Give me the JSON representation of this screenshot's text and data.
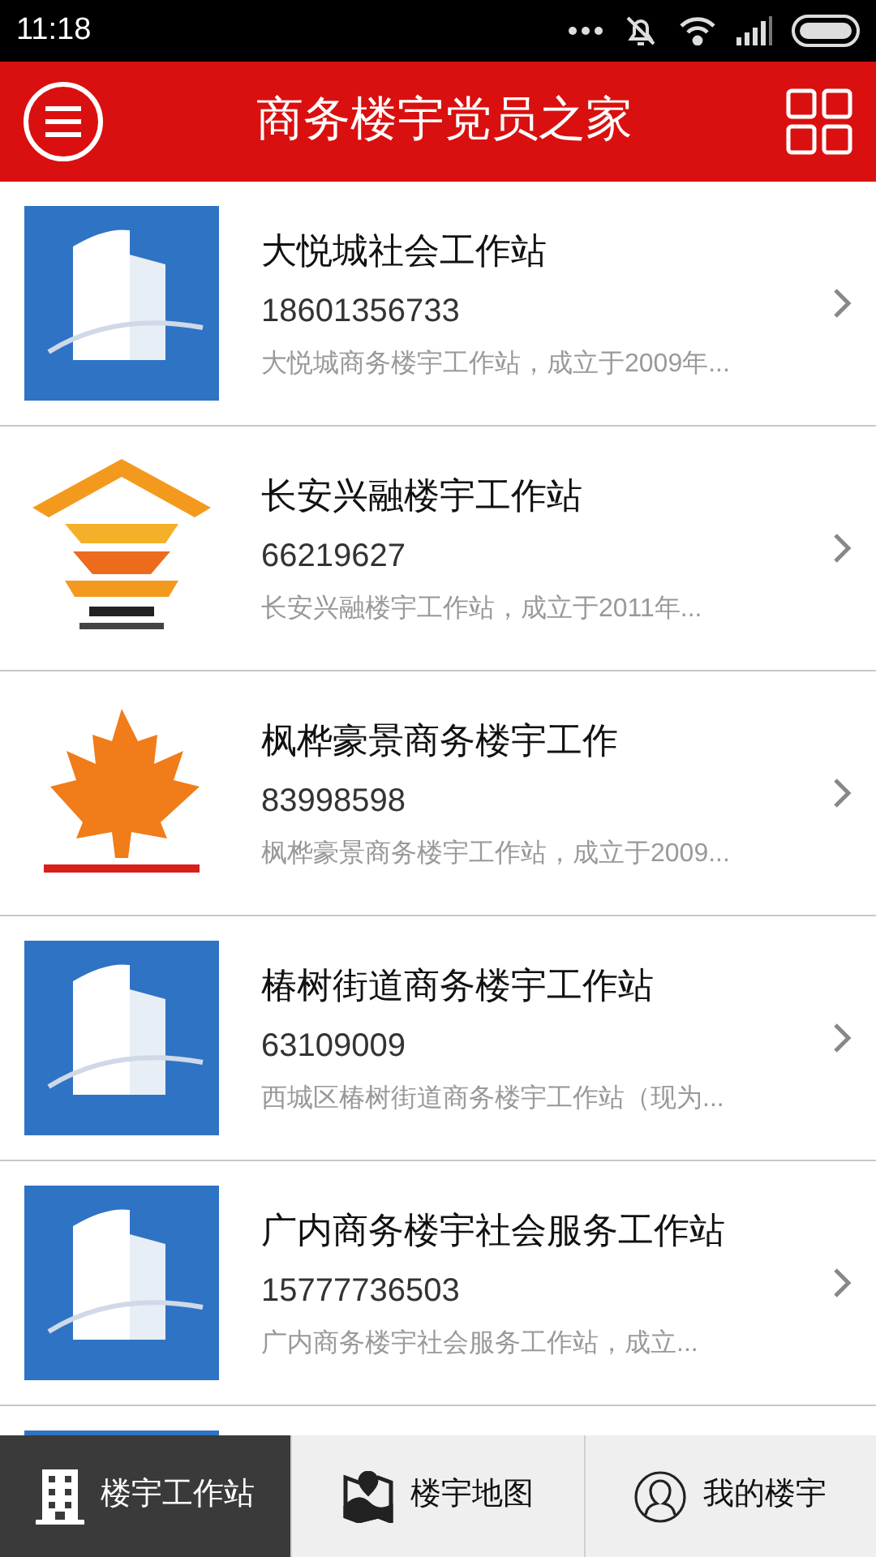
{
  "status_bar": {
    "time": "11:18"
  },
  "header": {
    "title": "商务楼宇党员之家"
  },
  "stations": [
    {
      "kind": "building",
      "name": "大悦城社会工作站",
      "phone": "18601356733",
      "description": "大悦城商务楼宇工作站，成立于2009年..."
    },
    {
      "kind": "ribbon",
      "name": "长安兴融楼宇工作站",
      "phone": "66219627",
      "description": "长安兴融楼宇工作站，成立于2011年..."
    },
    {
      "kind": "maple",
      "name": "枫桦豪景商务楼宇工作",
      "phone": "83998598",
      "description": "枫桦豪景商务楼宇工作站，成立于2009..."
    },
    {
      "kind": "building",
      "name": "椿树街道商务楼宇工作站",
      "phone": "63109009",
      "description": "西城区椿树街道商务楼宇工作站（现为..."
    },
    {
      "kind": "building",
      "name": "广内商务楼宇社会服务工作站",
      "phone": "15777736503",
      "description": "广内商务楼宇社会服务工作站，成立..."
    },
    {
      "kind": "building"
    }
  ],
  "tabs": [
    {
      "label": "楼宇工作站",
      "selected": true
    },
    {
      "label": "楼宇地图",
      "selected": false
    },
    {
      "label": "我的楼宇",
      "selected": false
    }
  ]
}
